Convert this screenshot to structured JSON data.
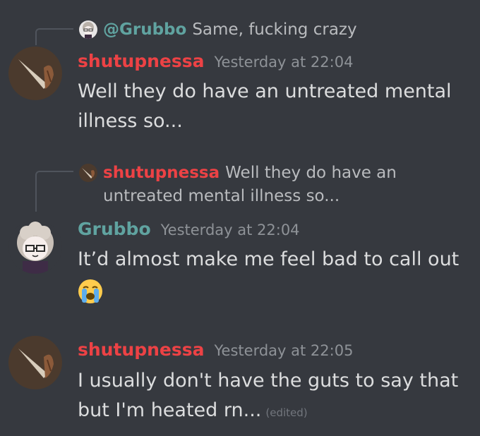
{
  "reply1": {
    "mention": "@Grubbo",
    "text": "Same, fucking crazy"
  },
  "message1": {
    "username": "shutupnessa",
    "timestamp": "Yesterday at 22:04",
    "text": "Well they do have an untreated mental illness so..."
  },
  "reply2": {
    "name": "shutupnessa",
    "text": "Well they do have an untreated mental illness so..."
  },
  "message2": {
    "username": "Grubbo",
    "timestamp": "Yesterday at 22:04",
    "text": "It’d almost make me feel bad to call out",
    "emoji": "😭"
  },
  "message3": {
    "username": "shutupnessa",
    "timestamp": "Yesterday at 22:05",
    "text": "I usually don't have the guts to say that but I'm heated rn...",
    "edited": "(edited)"
  },
  "colors": {
    "background": "#36393f",
    "red_role": "#ed4245",
    "teal_role": "#60a3a0",
    "text": "#dcddde",
    "muted": "#8e9297"
  }
}
